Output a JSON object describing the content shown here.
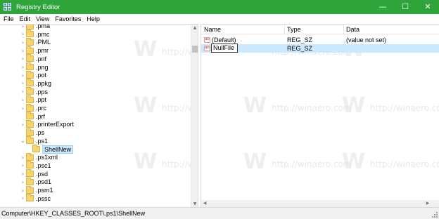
{
  "window": {
    "title": "Registry Editor",
    "minimize_glyph": "—",
    "maximize_glyph": "☐",
    "close_glyph": "✕",
    "accent": "#2ea43a"
  },
  "menu": {
    "file": "File",
    "edit": "Edit",
    "view": "View",
    "favorites": "Favorites",
    "help": "Help"
  },
  "tree": {
    "items": [
      {
        "label": ".pma",
        "chevron": "›",
        "selected": false
      },
      {
        "label": ".pmc",
        "chevron": "›",
        "selected": false
      },
      {
        "label": ".PML",
        "chevron": "›",
        "selected": false
      },
      {
        "label": ".pmr",
        "chevron": "›",
        "selected": false
      },
      {
        "label": ".pnf",
        "chevron": "›",
        "selected": false
      },
      {
        "label": ".png",
        "chevron": "›",
        "selected": false
      },
      {
        "label": ".pot",
        "chevron": "›",
        "selected": false
      },
      {
        "label": ".ppkg",
        "chevron": "›",
        "selected": false
      },
      {
        "label": ".pps",
        "chevron": "›",
        "selected": false
      },
      {
        "label": ".ppt",
        "chevron": "›",
        "selected": false
      },
      {
        "label": ".prc",
        "chevron": "›",
        "selected": false
      },
      {
        "label": ".prf",
        "chevron": "",
        "selected": false
      },
      {
        "label": ".printerExport",
        "chevron": "›",
        "selected": false
      },
      {
        "label": ".ps",
        "chevron": "",
        "selected": false
      },
      {
        "label": ".ps1",
        "chevron": "⌄",
        "selected": false
      },
      {
        "label": "ShellNew",
        "chevron": "",
        "selected": true
      },
      {
        "label": ".ps1xml",
        "chevron": "›",
        "selected": false
      },
      {
        "label": ".psc1",
        "chevron": "›",
        "selected": false
      },
      {
        "label": ".psd",
        "chevron": "›",
        "selected": false
      },
      {
        "label": ".psd1",
        "chevron": "›",
        "selected": false
      },
      {
        "label": ".psm1",
        "chevron": "›",
        "selected": false
      },
      {
        "label": ".pssc",
        "chevron": "›",
        "selected": false
      }
    ]
  },
  "list": {
    "headers": {
      "name": "Name",
      "type": "Type",
      "data": "Data"
    },
    "rows": [
      {
        "icon": "ab",
        "name": "(Default)",
        "type": "REG_SZ",
        "data": "(value not set)",
        "selected": false
      },
      {
        "icon": "ab",
        "name": "NullFile",
        "type": "REG_SZ",
        "data": "",
        "selected": true,
        "editing": true
      }
    ]
  },
  "watermark": {
    "text": "http://winaero.com",
    "letter": "W"
  },
  "status": {
    "path": "Computer\\HKEY_CLASSES_ROOT\\.ps1\\ShellNew"
  }
}
